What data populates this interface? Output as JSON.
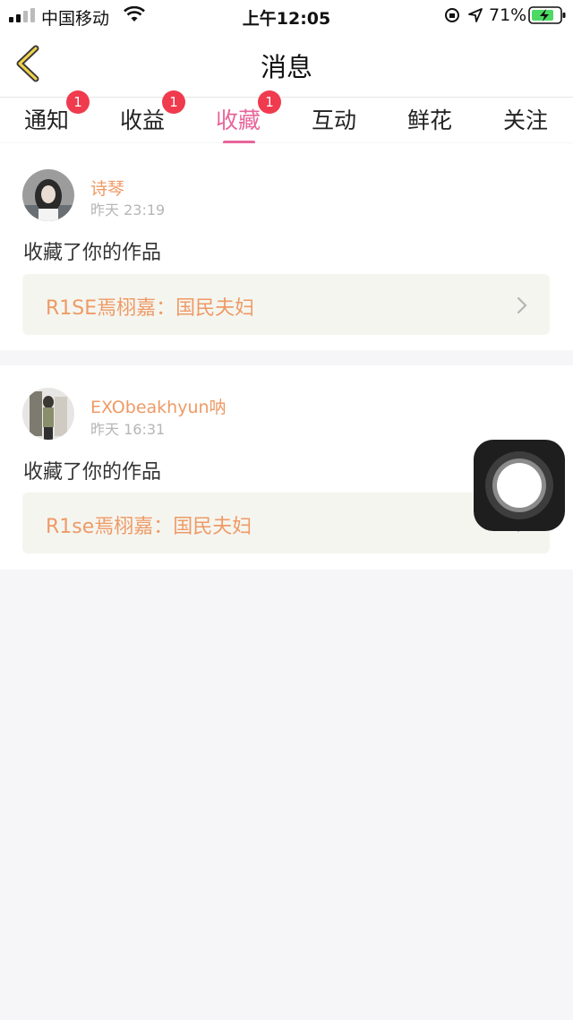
{
  "status_bar": {
    "carrier": "中国移动",
    "time": "上午12:05",
    "battery_percent": "71%",
    "icons": [
      "signal-icon",
      "wifi-icon",
      "orientation-lock-icon",
      "location-arrow-icon",
      "battery-charging-icon"
    ]
  },
  "nav": {
    "title": "消息",
    "back_icon": "chevron-left-icon"
  },
  "tabs": [
    {
      "label": "通知",
      "badge": "1",
      "active": false
    },
    {
      "label": "收益",
      "badge": "1",
      "active": false
    },
    {
      "label": "收藏",
      "badge": "1",
      "active": true
    },
    {
      "label": "互动",
      "badge": "",
      "active": false
    },
    {
      "label": "鲜花",
      "badge": "",
      "active": false
    },
    {
      "label": "关注",
      "badge": "",
      "active": false
    }
  ],
  "messages": [
    {
      "username": "诗琴",
      "time": "昨天 23:19",
      "action": "收藏了你的作品",
      "work_title": "R1SE焉栩嘉：国民夫妇"
    },
    {
      "username": "EXObeakhyun呐",
      "time": "昨天 16:31",
      "action": "收藏了你的作品",
      "work_title": "R1se焉栩嘉：国民夫妇"
    }
  ],
  "colors": {
    "accent_pink": "#e8659a",
    "username_orange": "#ee9a66",
    "badge_red": "#f03a4e",
    "background": "#f6f5f8"
  }
}
